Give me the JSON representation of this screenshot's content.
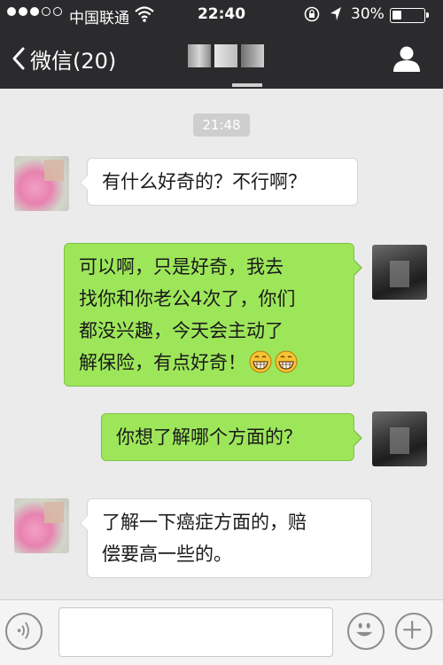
{
  "status_bar": {
    "carrier": "中国联通",
    "time": "22:40",
    "battery": "30%",
    "battery_level": 0.3,
    "signal_dots_filled": 3,
    "signal_dots_total": 5
  },
  "nav": {
    "back_label": "微信(20)"
  },
  "chat": {
    "timestamp": "21:48",
    "messages": [
      {
        "side": "left",
        "lines": [
          "有什么好奇的？不行啊？"
        ]
      },
      {
        "side": "right",
        "lines": [
          "可以啊，只是好奇，我去",
          "找你和你老公4次了，你们",
          "都没兴趣，今天会主动了",
          "解保险，有点好奇！"
        ],
        "emoji_suffix": [
          "grin-emoji",
          "grin-emoji"
        ]
      },
      {
        "side": "right",
        "lines": [
          "你想了解哪个方面的？"
        ]
      },
      {
        "side": "left",
        "lines": [
          "了解一下癌症方面的，赔",
          "偿要高一些的。"
        ]
      }
    ]
  },
  "input_bar": {
    "placeholder": "",
    "icons": [
      "voice-icon",
      "smiley-icon",
      "plus-icon"
    ]
  },
  "colors": {
    "header_bg": "#2b2b2e",
    "chat_bg": "#ebebeb",
    "sent_bubble": "#9de65a",
    "received_bubble": "#ffffff"
  }
}
